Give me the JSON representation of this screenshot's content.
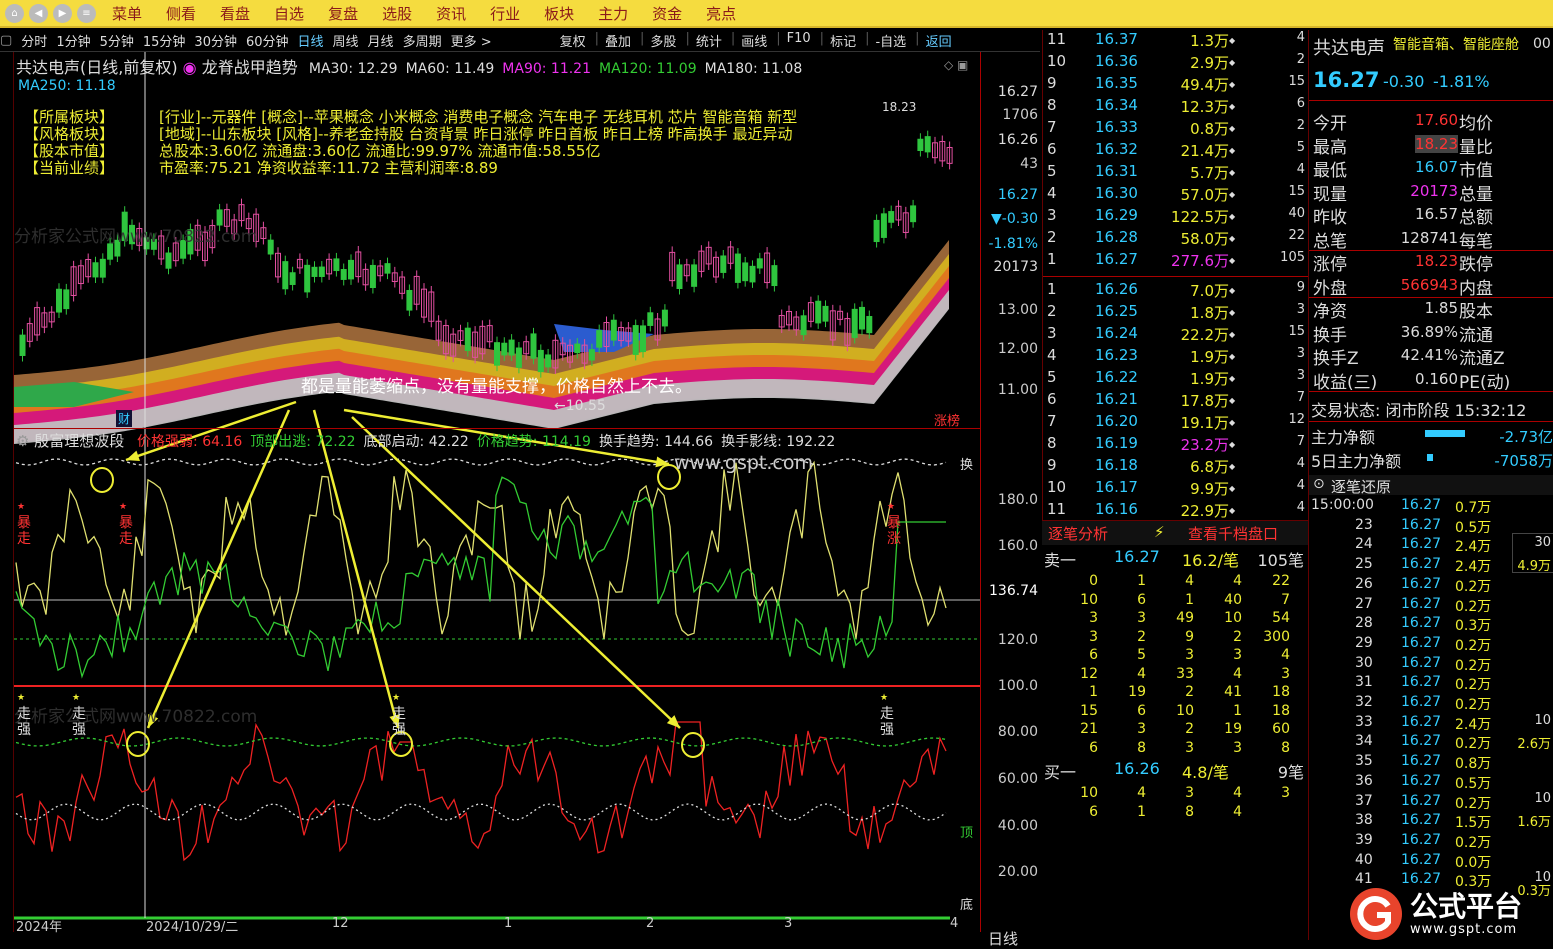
{
  "menu": [
    "菜单",
    "侧看",
    "看盘",
    "自选",
    "复盘",
    "选股",
    "资讯",
    "行业",
    "板块",
    "主力",
    "资金",
    "亮点"
  ],
  "periods": [
    "分时",
    "1分钟",
    "5分钟",
    "15分钟",
    "30分钟",
    "60分钟",
    "日线",
    "周线",
    "月线",
    "多周期",
    "更多 >"
  ],
  "tools": [
    "复权",
    "叠加",
    "多股",
    "统计",
    "画线",
    "F10",
    "标记",
    "-自选",
    "返回"
  ],
  "chart": {
    "stock_title": "共达电声(日线,前复权)",
    "indicator_name": "龙脊战甲趋势",
    "ma": [
      {
        "label": "MA30: 12.29",
        "color": "#ddd"
      },
      {
        "label": "MA60: 11.49",
        "color": "#ddd"
      },
      {
        "label": "MA90: 11.21",
        "color": "#e3e"
      },
      {
        "label": "MA120: 11.09",
        "color": "#3c3"
      },
      {
        "label": "MA180: 11.08",
        "color": "#ddd"
      }
    ],
    "ma250": "MA250: 11.18",
    "info_labels": [
      "【所属板块】",
      "【风格板块】",
      "【股本市值】",
      "【当前业绩】"
    ],
    "info_lines": [
      "[行业]--元器件 [概念]--苹果概念 小米概念 消费电子概念 汽车电子 无线耳机 芯片 智能音箱 新型",
      "[地域]--山东板块 [风格]--养老金持股 台资背景 昨日涨停 昨日首板 昨日上榜 昨高换手 最近异动",
      "总股本:3.60亿 流通盘:3.60亿 流通比:99.97% 流通市值:58.55亿",
      "市盈率:75.21 净资收益率:11.72 主营利润率:8.89"
    ],
    "annotation": "都是量能萎缩点，没有量能支撑，价格自然上不去。",
    "high_label": "18.23",
    "low_label": "←10.55",
    "cai": "财",
    "zhangbang": "涨榜",
    "watermark": "www.gspt.com",
    "wm1": "分析家公式网www.70822.com",
    "sub_title": "殷富理想波段",
    "sub_values": [
      {
        "label": "价格强弱: 64.16",
        "color": "#f33"
      },
      {
        "label": "顶部出逃: 72.22",
        "color": "#3c3"
      },
      {
        "label": "底部启动: 42.22",
        "color": "#ddd"
      },
      {
        "label": "价格趋势: 114.19",
        "color": "#3c3"
      },
      {
        "label": "换手趋势: 144.66",
        "color": "#ddd"
      },
      {
        "label": "换手影线: 192.22",
        "color": "#ddd"
      }
    ],
    "mark_baozou": "暴走",
    "mark_baozhang": "暴涨",
    "mark_zouqiang": "走强",
    "label_huan": "换",
    "label_ding": "顶",
    "label_di": "底",
    "x_labels": [
      "2024年",
      "2024/10/29/二",
      "12",
      "1",
      "2",
      "3",
      "4"
    ],
    "period_label": "日线"
  },
  "price_axis": {
    "top": [
      "16.27",
      "1706",
      "16.26",
      "43",
      "16.27",
      "▼-0.30",
      "-1.81%",
      "20173"
    ],
    "main": [
      "13.00",
      "12.00",
      "11.00"
    ],
    "sub": [
      "180.0",
      "160.0",
      "136.74",
      "120.0",
      "100.0",
      "80.00",
      "60.00",
      "40.00",
      "20.00"
    ]
  },
  "asks": [
    [
      "11",
      "16.37",
      "1.3万",
      "4"
    ],
    [
      "10",
      "16.36",
      "2.9万",
      "2"
    ],
    [
      "9",
      "16.35",
      "49.4万",
      "15"
    ],
    [
      "8",
      "16.34",
      "12.3万",
      "6"
    ],
    [
      "7",
      "16.33",
      "0.8万",
      "2"
    ],
    [
      "6",
      "16.32",
      "21.4万",
      "5"
    ],
    [
      "5",
      "16.31",
      "5.7万",
      "4"
    ],
    [
      "4",
      "16.30",
      "57.0万",
      "15"
    ],
    [
      "3",
      "16.29",
      "122.5万",
      "40"
    ],
    [
      "2",
      "16.28",
      "58.0万",
      "22"
    ],
    [
      "1",
      "16.27",
      "277.6万",
      "105"
    ]
  ],
  "bids": [
    [
      "1",
      "16.26",
      "7.0万",
      "9"
    ],
    [
      "2",
      "16.25",
      "1.8万",
      "3"
    ],
    [
      "3",
      "16.24",
      "22.2万",
      "15"
    ],
    [
      "4",
      "16.23",
      "1.9万",
      "3"
    ],
    [
      "5",
      "16.22",
      "1.9万",
      "3"
    ],
    [
      "6",
      "16.21",
      "17.8万",
      "7"
    ],
    [
      "7",
      "16.20",
      "19.1万",
      "12"
    ],
    [
      "8",
      "16.19",
      "23.2万",
      "7"
    ],
    [
      "9",
      "16.18",
      "6.8万",
      "4"
    ],
    [
      "10",
      "16.17",
      "9.9万",
      "4"
    ],
    [
      "11",
      "16.16",
      "22.9万",
      "4"
    ]
  ],
  "tick": {
    "tab1": "逐笔分析",
    "tab2": "查看千档盘口",
    "sell_label": "卖一",
    "sell_price": "16.27",
    "sell_vol": "16.2/笔",
    "sell_count": "105笔",
    "sell_rows": [
      [
        "0",
        "1",
        "4",
        "4",
        "22"
      ],
      [
        "10",
        "6",
        "1",
        "40",
        "7"
      ],
      [
        "3",
        "3",
        "49",
        "10",
        "54"
      ],
      [
        "3",
        "2",
        "9",
        "2",
        "300"
      ],
      [
        "6",
        "5",
        "3",
        "3",
        "4"
      ],
      [
        "12",
        "4",
        "33",
        "4",
        "3"
      ],
      [
        "1",
        "19",
        "2",
        "41",
        "18"
      ],
      [
        "15",
        "6",
        "10",
        "1",
        "18"
      ],
      [
        "21",
        "3",
        "2",
        "19",
        "60"
      ],
      [
        "6",
        "8",
        "3",
        "3",
        "8"
      ]
    ],
    "buy_label": "买一",
    "buy_price": "16.26",
    "buy_vol": "4.8/笔",
    "buy_count": "9笔",
    "buy_rows": [
      [
        "10",
        "4",
        "3",
        "4",
        "3"
      ],
      [
        "6",
        "1",
        "8",
        "4",
        ""
      ]
    ]
  },
  "quote": {
    "name": "共达电声",
    "concept": "智能音箱、智能座舱",
    "concept_tail": "00",
    "price": "16.27",
    "change": "-0.30",
    "pct": "-1.81%",
    "rows": [
      [
        "今开",
        "17.60",
        "均价"
      ],
      [
        "最高",
        "18.23",
        "量比"
      ],
      [
        "最低",
        "16.07",
        "市值"
      ],
      [
        "现量",
        "20173",
        "总量"
      ],
      [
        "昨收",
        "16.57",
        "总额"
      ],
      [
        "总笔",
        "128741",
        "每笔"
      ],
      [
        "涨停",
        "18.23",
        "跌停"
      ],
      [
        "外盘",
        "566943",
        "内盘"
      ],
      [
        "净资",
        "1.85",
        "股本"
      ],
      [
        "换手",
        "36.89%",
        "流通"
      ],
      [
        "换手Z",
        "42.41%",
        "流通Z"
      ],
      [
        "收益(三)",
        "0.160",
        "PE(动)"
      ]
    ],
    "trade_state": "交易状态: 闭市阶段 15:32:12",
    "main_net_label": "主力净额",
    "main_net": "-2.73亿",
    "main5_label": "5日主力净额",
    "main5": "-7058万"
  },
  "replay": {
    "title": "逐笔还原",
    "rows": [
      [
        "15:00:00",
        "16.27",
        "0.7万"
      ],
      [
        "23",
        "16.27",
        "0.5万"
      ],
      [
        "24",
        "16.27",
        "2.4万"
      ],
      [
        "25",
        "16.27",
        "2.4万"
      ],
      [
        "26",
        "16.27",
        "0.2万"
      ],
      [
        "27",
        "16.27",
        "0.2万"
      ],
      [
        "28",
        "16.27",
        "0.3万"
      ],
      [
        "29",
        "16.27",
        "0.2万"
      ],
      [
        "30",
        "16.27",
        "0.2万"
      ],
      [
        "31",
        "16.27",
        "0.2万"
      ],
      [
        "32",
        "16.27",
        "0.2万"
      ],
      [
        "33",
        "16.27",
        "2.4万"
      ],
      [
        "34",
        "16.27",
        "0.2万"
      ],
      [
        "35",
        "16.27",
        "0.8万"
      ],
      [
        "36",
        "16.27",
        "0.5万"
      ],
      [
        "37",
        "16.27",
        "0.2万"
      ],
      [
        "38",
        "16.27",
        "1.5万"
      ],
      [
        "39",
        "16.27",
        "0.2万"
      ],
      [
        "40",
        "16.27",
        "0.0万"
      ],
      [
        "41",
        "16.27",
        "0.3万"
      ]
    ],
    "side": [
      "30",
      "4.9万",
      "10",
      "2.6万",
      "10",
      "1.6万",
      "10",
      "0.3万"
    ]
  },
  "logo": {
    "name": "公式平台",
    "url": "www.gspt.com"
  }
}
